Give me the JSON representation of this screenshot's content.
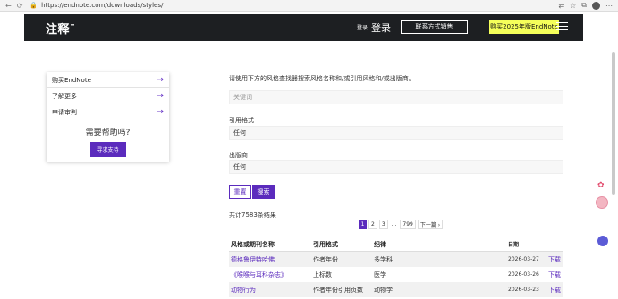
{
  "browser": {
    "url": "https://endnote.com/downloads/styles/",
    "nav_back": "←",
    "nav_reload": "⟳",
    "lock": "🔒"
  },
  "header": {
    "logo": "注释",
    "logo_tm": "™",
    "login_small": "登录",
    "login_big": "登录",
    "contact_label": "联系方式销售",
    "buy_label": "购买2025年版EndNote"
  },
  "sidebar": {
    "items": [
      {
        "label": "购买EndNote",
        "icon": "arrow-right-icon"
      },
      {
        "label": "了解更多",
        "icon": "arrow-right-icon"
      },
      {
        "label": "申请审判",
        "icon": "arrow-right-icon"
      }
    ],
    "arrow": "→",
    "help_title": "需要帮助吗?",
    "support_label": "寻求支持"
  },
  "search": {
    "intro": "请使用下方的风格查找器搜索风格名称和/或引用风格和/或出版商。",
    "keyword_placeholder": "关键词",
    "style_label": "引用格式",
    "style_value": "任何",
    "publisher_label": "出版商",
    "publisher_value": "任何",
    "reset_label": "重置",
    "search_label": "搜索"
  },
  "results": {
    "total": "共计7583条结果",
    "pages": [
      "1",
      "2",
      "3",
      "...",
      "799"
    ],
    "next_label": "下一篇 ›"
  },
  "table": {
    "headers": [
      "风格或期刊名称",
      "引用格式",
      "纪律",
      "",
      "日期"
    ],
    "rows": [
      {
        "name": "德格鲁伊特哈佛",
        "style": "作者年份",
        "discipline": "多学科",
        "date": "2026-03-27",
        "action": "下载"
      },
      {
        "name": "《喉喉与耳科杂志》",
        "style": "上标数",
        "discipline": "医学",
        "date": "2026-03-26",
        "action": "下载"
      },
      {
        "name": "动物行为",
        "style": "作者年份引用页数",
        "discipline": "动物学",
        "date": "2026-03-23",
        "action": "下载"
      }
    ]
  },
  "colors": {
    "accent": "#5b2bbd",
    "header_bg": "#1d1f22",
    "buy_bg": "#f5ff5a"
  }
}
